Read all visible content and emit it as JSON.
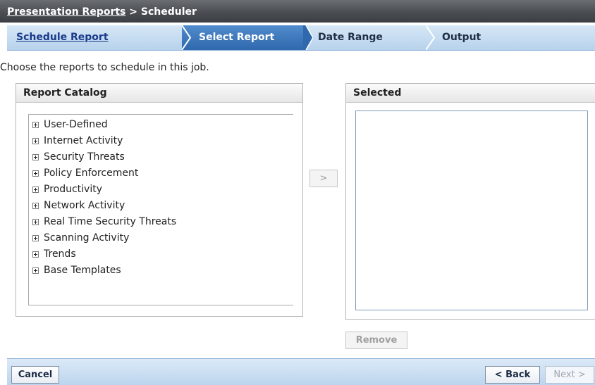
{
  "header": {
    "breadcrumb_root": "Presentation Reports",
    "breadcrumb_separator": ">",
    "breadcrumb_current": "Scheduler"
  },
  "wizard": {
    "steps": [
      {
        "label": "Schedule Report",
        "state": "link"
      },
      {
        "label": "Select Report",
        "state": "active"
      },
      {
        "label": "Date Range",
        "state": "inactive"
      },
      {
        "label": "Output",
        "state": "inactive"
      }
    ]
  },
  "instructions": "Choose the reports to schedule in this job.",
  "catalog": {
    "title": "Report Catalog",
    "items": [
      {
        "label": "User-Defined"
      },
      {
        "label": "Internet Activity"
      },
      {
        "label": "Security Threats"
      },
      {
        "label": "Policy Enforcement"
      },
      {
        "label": "Productivity"
      },
      {
        "label": "Network Activity"
      },
      {
        "label": "Real Time Security Threats"
      },
      {
        "label": "Scanning Activity"
      },
      {
        "label": "Trends"
      },
      {
        "label": "Base Templates"
      }
    ]
  },
  "add_button_label": ">",
  "selected_panel": {
    "title": "Selected",
    "items": []
  },
  "remove_button_label": "Remove",
  "footer": {
    "cancel_label": "Cancel",
    "back_label": "< Back",
    "next_label": "Next >"
  },
  "colors": {
    "title_bar": "#4a4d52",
    "step_bar": "#c6dcf1",
    "active_step": "#3f7bc0",
    "link": "#1a3a8a"
  },
  "icons": {
    "tree_expander": "plus-box-icon",
    "wizard_separator": "chevron-right-icon"
  }
}
